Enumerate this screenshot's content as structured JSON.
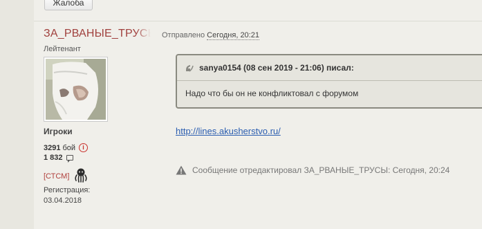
{
  "toolbar": {
    "report_label": "Жалоба"
  },
  "author": {
    "name": "ЗА_РВАНЫЕ_ТРУСЫ",
    "rank": "Лейтенант",
    "group": "Игроки",
    "battles_value": "3291",
    "battles_label": "бой",
    "posts_value": "1 832",
    "clan": "[СТСМ]",
    "registration_label": "Регистрация:",
    "registration_date": "03.04.2018"
  },
  "post": {
    "posted_prefix": "Отправлено",
    "posted_time": "Сегодня, 20:21",
    "quote": {
      "header": "sanya0154 (08 сен 2019 - 21:06) писал:",
      "text": "Надо что бы он не конфликтовал с форумом"
    },
    "link": "http://lines.akusherstvo.ru/",
    "edit_note": "Сообщение отредактировал ЗА_РВАНЫЕ_ТРУСЫ: Сегодня, 20:24"
  },
  "colors": {
    "author_name": "#a0403d",
    "link": "#2a5db0",
    "background": "#f0efea"
  }
}
